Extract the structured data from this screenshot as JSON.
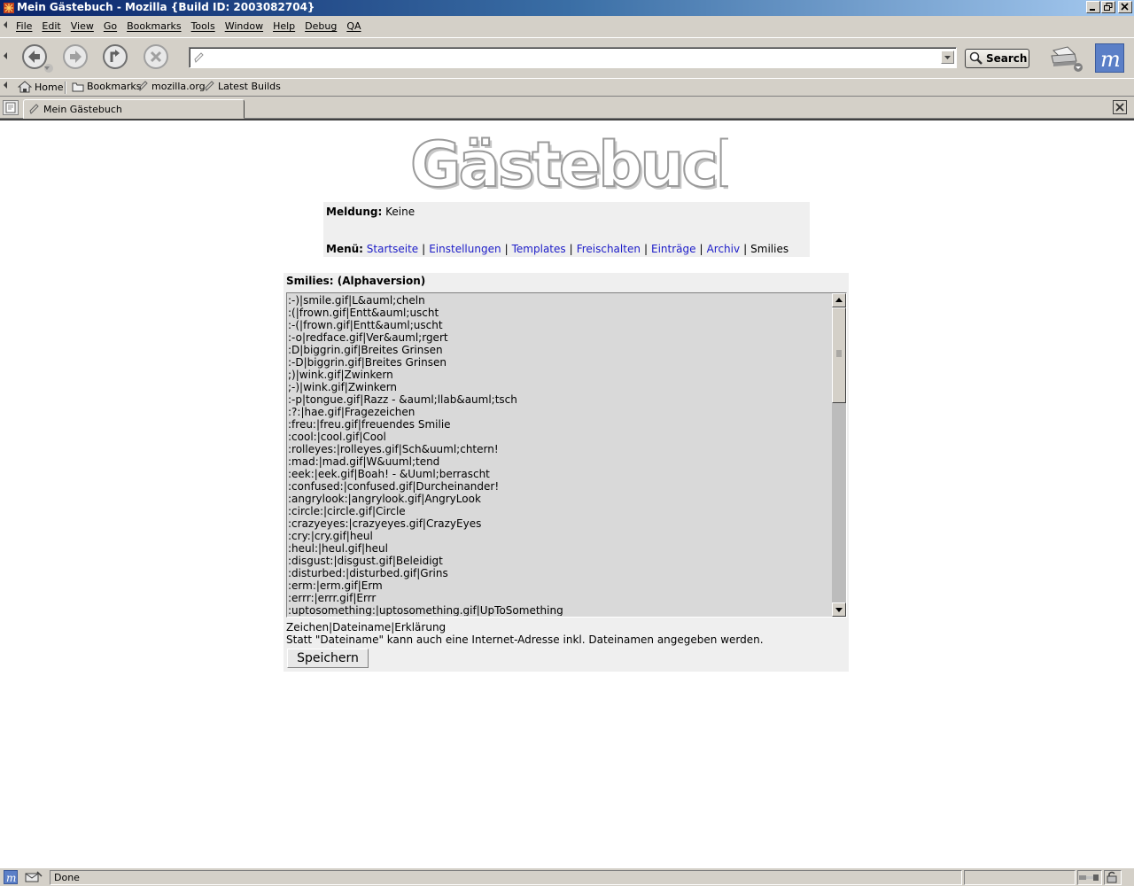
{
  "window": {
    "title": "Mein Gästebuch - Mozilla {Build ID: 2003082704}"
  },
  "menubar": {
    "items": [
      "File",
      "Edit",
      "View",
      "Go",
      "Bookmarks",
      "Tools",
      "Window",
      "Help",
      "Debug",
      "QA"
    ]
  },
  "navbar": {
    "url_value": "",
    "search_label": "Search"
  },
  "personal_toolbar": {
    "home": "Home",
    "bookmarks": "Bookmarks",
    "link1": "mozilla.org",
    "link2": "Latest Builds"
  },
  "tabs": [
    {
      "label": "Mein Gästebuch"
    }
  ],
  "page": {
    "logo_text": "Gästebuch",
    "meldung_label": "Meldung:",
    "meldung_value": "Keine",
    "menu_label": "Menü:",
    "menu_links": [
      "Startseite",
      "Einstellungen",
      "Templates",
      "Freischalten",
      "Einträge",
      "Archiv"
    ],
    "menu_current": "Smilies",
    "smilies_heading": "Smilies: (Alphaversion)",
    "smilies_lines": [
      ":-)|smile.gif|L&auml;cheln",
      ":(|frown.gif|Entt&auml;uscht",
      ":-(|frown.gif|Entt&auml;uscht",
      ":-o|redface.gif|Ver&auml;rgert",
      ":D|biggrin.gif|Breites Grinsen",
      ":-D|biggrin.gif|Breites Grinsen",
      ";)|wink.gif|Zwinkern",
      ";-)|wink.gif|Zwinkern",
      ":-p|tongue.gif|Razz - &auml;llab&auml;tsch",
      ":?:|hae.gif|Fragezeichen",
      ":freu:|freu.gif|freuendes Smilie",
      ":cool:|cool.gif|Cool",
      ":rolleyes:|rolleyes.gif|Sch&uuml;chtern!",
      ":mad:|mad.gif|W&uuml;tend",
      ":eek:|eek.gif|Boah! - &Uuml;berrascht",
      ":confused:|confused.gif|Durcheinander!",
      ":angrylook:|angrylook.gif|AngryLook",
      ":circle:|circle.gif|Circle",
      ":crazyeyes:|crazyeyes.gif|CrazyEyes",
      ":cry:|cry.gif|heul",
      ":heul:|heul.gif|heul",
      ":disgust:|disgust.gif|Beleidigt",
      ":disturbed:|disturbed.gif|Grins",
      ":erm:|erm.gif|Erm",
      ":errr:|errr.gif|Errr",
      ":uptosomething:|uptosomething.gif|UpToSomething"
    ],
    "hint_line1": "Zeichen|Dateiname|Erklärung",
    "hint_line2": "Statt \"Dateiname\" kann auch eine Internet-Adresse inkl. Dateinamen angegeben werden.",
    "save_label": "Speichern"
  },
  "status": {
    "text": "Done"
  },
  "colors": {
    "link": "#1c1cc8",
    "titlebar_start": "#0a246a",
    "titlebar_end": "#a6caf0",
    "panel": "#efefef",
    "chrome": "#d4d0c8"
  },
  "icons": [
    "app-icon",
    "minimize-icon",
    "maximize-icon",
    "close-icon",
    "back-icon",
    "forward-icon",
    "reload-icon",
    "stop-icon",
    "page-icon",
    "search-icon",
    "print-icon",
    "throbber-icon",
    "home-icon",
    "bookmarks-folder-icon",
    "bookmark-link-icon",
    "new-tab-icon",
    "tab-close-icon",
    "scroll-up-icon",
    "scroll-down-icon",
    "mozilla-status-icon",
    "mail-status-icon",
    "lock-icon",
    "online-icon"
  ]
}
